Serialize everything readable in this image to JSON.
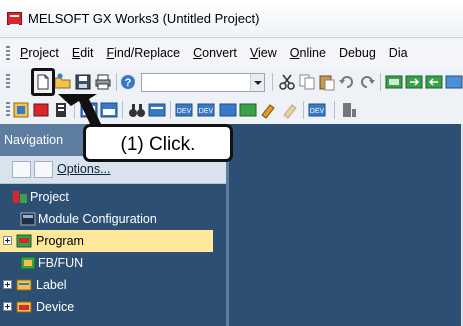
{
  "window": {
    "title": "MELSOFT GX Works3 (Untitled Project)"
  },
  "menu": {
    "items": [
      {
        "label": "Project",
        "underline": "P",
        "rest": "roject"
      },
      {
        "label": "Edit",
        "underline": "E",
        "rest": "dit"
      },
      {
        "label": "Find/Replace",
        "underline": "F",
        "rest": "ind/Replace"
      },
      {
        "label": "Convert",
        "underline": "C",
        "rest": "onvert"
      },
      {
        "label": "View",
        "underline": "V",
        "rest": "iew"
      },
      {
        "label": "Online",
        "underline": "O",
        "rest": "nline"
      },
      {
        "label": "Debug",
        "underline": "",
        "rest": "Debug"
      },
      {
        "label": "Dia",
        "underline": "",
        "rest": "Dia"
      }
    ]
  },
  "navigation": {
    "title": "Navigation",
    "options_label": "Options...",
    "tree": [
      {
        "label": "Project",
        "icon": "project-icon"
      },
      {
        "label": "Module Configuration",
        "icon": "module-configuration-icon"
      },
      {
        "label": "Program",
        "icon": "program-icon",
        "selected": true
      },
      {
        "label": "FB/FUN",
        "icon": "fb-fun-icon"
      },
      {
        "label": "Label",
        "icon": "label-icon"
      },
      {
        "label": "Device",
        "icon": "device-icon"
      }
    ]
  },
  "callout": {
    "text": "(1) Click."
  },
  "colors": {
    "nav_background": "#2d4f73",
    "nav_header": "#5d7ea0",
    "selection": "#ffe89a"
  }
}
